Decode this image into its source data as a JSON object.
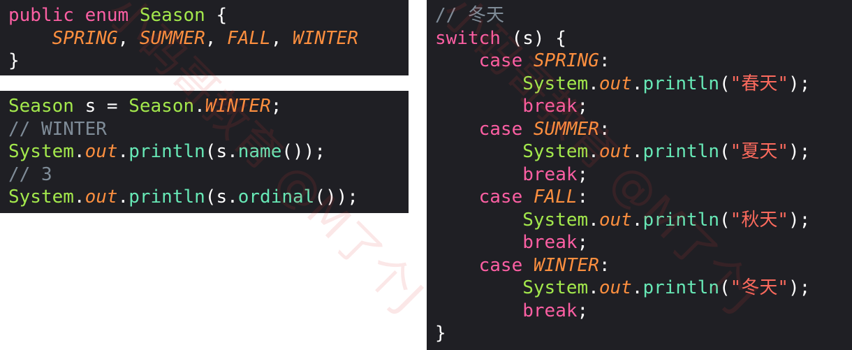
{
  "panel_enum": {
    "l1": {
      "kw1": "public",
      "kw2": "enum",
      "name": "Season",
      "brace": "{"
    },
    "l2": {
      "c1": "SPRING",
      "c2": "SUMMER",
      "c3": "FALL",
      "c4": "WINTER",
      "sep": ", "
    },
    "l3": {
      "brace": "}"
    }
  },
  "panel_usage": {
    "l1": {
      "type": "Season",
      "var": "s",
      "eq": " = ",
      "cls": "Season",
      "dot": ".",
      "const": "WINTER",
      "semi": ";"
    },
    "l2": {
      "comment": "// WINTER"
    },
    "l3": {
      "cls": "System",
      "field": "out",
      "method": "println",
      "arg_var": "s",
      "arg_method": "name"
    },
    "l4": {
      "comment": "// 3"
    },
    "l5": {
      "cls": "System",
      "field": "out",
      "method": "println",
      "arg_var": "s",
      "arg_method": "ordinal"
    }
  },
  "panel_switch": {
    "comment": "// 冬天",
    "switch_kw": "switch",
    "switch_arg": "(s)",
    "open_brace": "{",
    "case_kw": "case",
    "break_kw": "break",
    "sys": "System",
    "out": "out",
    "println": "println",
    "cases": [
      {
        "label": "SPRING",
        "text": "\"春天\""
      },
      {
        "label": "SUMMER",
        "text": "\"夏天\""
      },
      {
        "label": "FALL",
        "text": "\"秋天\""
      },
      {
        "label": "WINTER",
        "text": "\"冬天\""
      }
    ],
    "close_brace": "}"
  },
  "watermark": {
    "text": "小码哥教育 @M了个J"
  }
}
